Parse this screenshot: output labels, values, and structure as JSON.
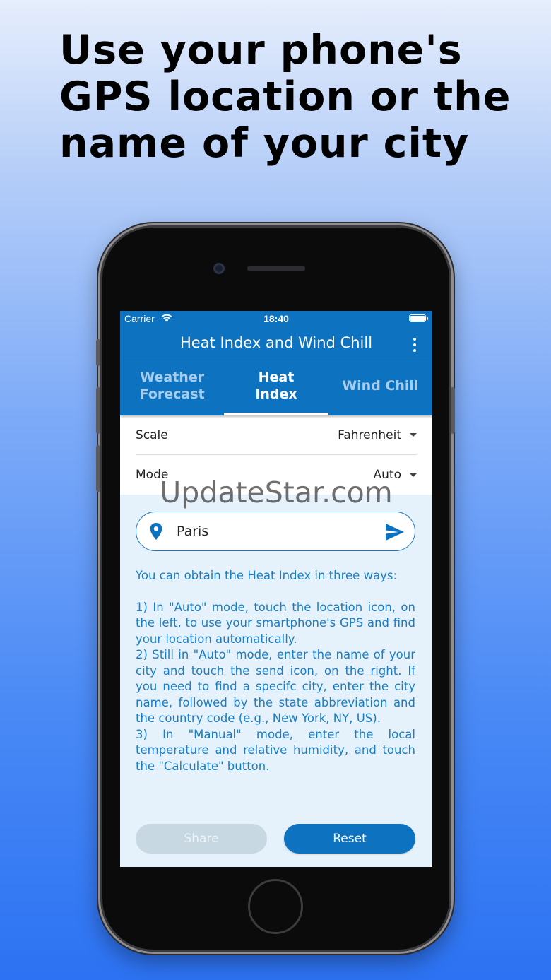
{
  "headline": "Use your phone's GPS location or the name of your city",
  "status_bar": {
    "carrier": "Carrier",
    "time": "18:40",
    "wifi_icon": "wifi-icon",
    "battery_icon": "battery-icon"
  },
  "app_bar": {
    "title": "Heat Index and Wind Chill",
    "menu_icon": "more-vert-icon"
  },
  "tabs": [
    {
      "label": "Weather Forecast",
      "active": false
    },
    {
      "label": "Heat Index",
      "active": true
    },
    {
      "label": "Wind Chill",
      "active": false
    }
  ],
  "settings": {
    "scale": {
      "label": "Scale",
      "value": "Fahrenheit"
    },
    "mode": {
      "label": "Mode",
      "value": "Auto"
    }
  },
  "watermark": "UpdateStar.com",
  "search": {
    "value": "Paris",
    "location_icon": "location-pin-icon",
    "send_icon": "send-icon"
  },
  "info": {
    "intro": "You can obtain the Heat Index in three ways:",
    "step1": "1) In \"Auto\" mode, touch the location icon, on the left, to use your smartphone's GPS and find your location automatically.",
    "step2": "2) Still in \"Auto\" mode, enter the name of your city and touch the send icon, on the right. If you need to find a specifc city, enter the city name, followed by the state abbreviation and the country code (e.g., New York, NY, US).",
    "step3": "3) In \"Manual\" mode, enter the local temperature and relative humidity, and touch the \"Calculate\" button."
  },
  "buttons": {
    "share": "Share",
    "reset": "Reset"
  },
  "colors": {
    "primary": "#0d72bf",
    "screen_bg": "#e5f2fc",
    "info_text": "#1a7dc7",
    "disabled_button": "#c7d8e3"
  }
}
